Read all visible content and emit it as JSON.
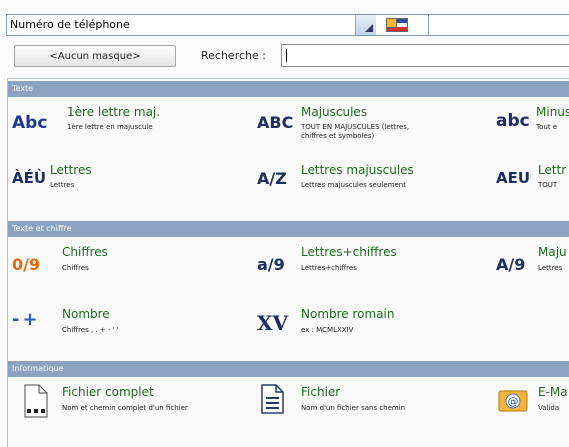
{
  "combo": {
    "value": "Numéro de téléphone"
  },
  "toolbar": {
    "mask_label": "<Aucun masque>",
    "search_label": "Recherche :",
    "search_value": ""
  },
  "sections": [
    {
      "title": "Texte"
    },
    {
      "title": "Texte et chiffre"
    },
    {
      "title": "Informatique"
    }
  ],
  "texte": [
    {
      "icon": "Abc",
      "title": "1ère lettre maj.",
      "desc": "1ère lettre en majuscule"
    },
    {
      "icon": "ABC",
      "title": "Majuscules",
      "desc": "TOUT EN MAJUSCULES (lettres,",
      "desc2": "chiffres et symboles)"
    },
    {
      "icon": "abc",
      "title": "Minus",
      "desc": "Tout e"
    },
    {
      "icon": "ÀÉÙ",
      "title": "Lettres",
      "desc": "Lettres"
    },
    {
      "icon": "A/Z",
      "title": "Lettres majuscules",
      "desc": "Lettres majuscules seulement"
    },
    {
      "icon": "AEU",
      "title": "Lettr",
      "desc": "TOUT"
    }
  ],
  "texte_chiffre": [
    {
      "icon": "0/9",
      "title": "Chiffres",
      "desc": "Chiffres"
    },
    {
      "icon": "a/9",
      "title": "Lettres+chiffres",
      "desc": "Lettres+chiffres"
    },
    {
      "icon": "A/9",
      "title": "Maju",
      "desc": "Lettres"
    },
    {
      "icon": "-+",
      "title": "Nombre",
      "desc": "Chiffres , . + - ' '"
    },
    {
      "icon": "XV",
      "title": "Nombre romain",
      "desc": "ex : MCMLXXIV"
    }
  ],
  "informatique": [
    {
      "icon": "file-dots-icon",
      "title": "Fichier complet",
      "desc": "Nom et chemin complet d'un fichier"
    },
    {
      "icon": "file-lines-icon",
      "title": "Fichier",
      "desc": "Nom d'un fichier sans chemin"
    },
    {
      "icon": "email-icon",
      "title": "E-Ma",
      "desc": "Valida"
    }
  ]
}
